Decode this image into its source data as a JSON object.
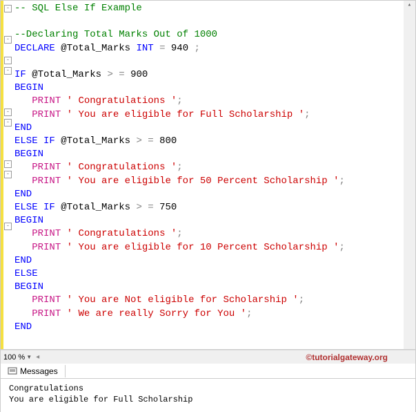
{
  "code": {
    "line1_comment": "-- SQL Else If Example",
    "line3_comment": "--Declaring Total Marks Out of 1000",
    "declare": "DECLARE",
    "var": "@Total_Marks",
    "int_type": "INT",
    "eq": "=",
    "val940": "940",
    "semi": ";",
    "if_kw": "IF",
    "gteq": "> =",
    "val900": "900",
    "begin": "BEGIN",
    "print": "PRINT",
    "str_congrats": "' Congratulations '",
    "str_full": "' You are eligible for Full Scholarship '",
    "end": "END",
    "else": "ELSE",
    "val800": "800",
    "str_50": "' You are eligible for 50 Percent Scholarship '",
    "val750": "750",
    "str_10": "' You are eligible for 10 Percent Scholarship '",
    "str_noteligible": "' You are Not eligible for Scholarship '",
    "str_sorry": "' We are really Sorry for You '"
  },
  "zoom": {
    "level": "100 %"
  },
  "watermark": "©tutorialgateway.org",
  "messages": {
    "tab_label": "Messages",
    "line1": "Congratulations",
    "line2": "You are eligible for Full Scholarship"
  }
}
